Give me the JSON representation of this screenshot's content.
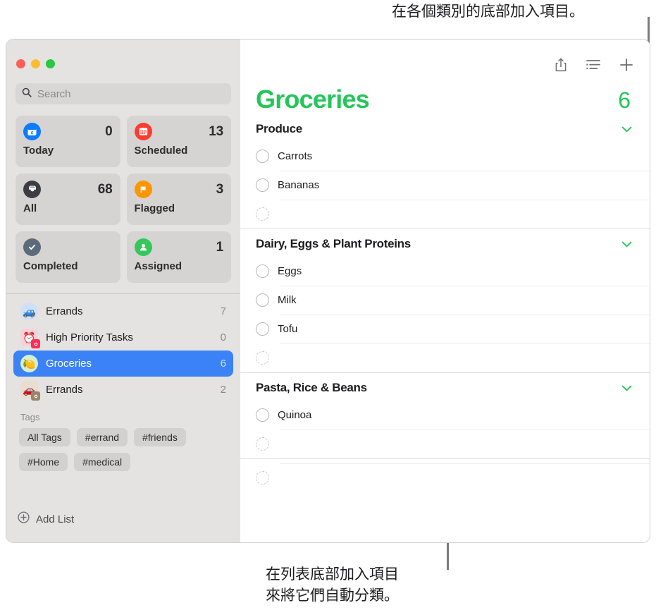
{
  "annotations": {
    "top": "在各個類別的底部加入項目。",
    "bottom": "在列表底部加入項目\n來將它們自動分類。"
  },
  "sidebar": {
    "search": {
      "placeholder": "Search",
      "icon": "search-icon"
    },
    "smart_lists": [
      {
        "label": "Today",
        "count": "0",
        "icon": "calendar-today-icon",
        "color": "#0a7cff"
      },
      {
        "label": "Scheduled",
        "count": "13",
        "icon": "calendar-icon",
        "color": "#ff3b30"
      },
      {
        "label": "All",
        "count": "68",
        "icon": "inbox-icon",
        "color": "#3c3c43"
      },
      {
        "label": "Flagged",
        "count": "3",
        "icon": "flag-icon",
        "color": "#ff9500"
      },
      {
        "label": "Completed",
        "count": "",
        "icon": "checkmark-icon",
        "color": "#5b6b79"
      },
      {
        "label": "Assigned",
        "count": "1",
        "icon": "person-icon",
        "color": "#34c759"
      }
    ],
    "lists": [
      {
        "label": "Errands",
        "count": "7",
        "glyph": "🚙",
        "bg": "#cfe0fa",
        "badge": false,
        "selected": false
      },
      {
        "label": "High Priority Tasks",
        "count": "0",
        "glyph": "⏰",
        "bg": "#fbd0dc",
        "badge": true,
        "badge_color": "#ff2d55",
        "selected": false
      },
      {
        "label": "Groceries",
        "count": "6",
        "glyph": "🍋",
        "bg": "#d3f0cf",
        "badge": false,
        "selected": true
      },
      {
        "label": "Errands",
        "count": "2",
        "glyph": "🚗",
        "bg": "#e8ddd0",
        "badge": true,
        "badge_color": "#9b8568",
        "selected": false
      }
    ],
    "tags_header": "Tags",
    "tags": [
      "All Tags",
      "#errand",
      "#friends",
      "#Home",
      "#medical"
    ],
    "add_list_label": "Add List",
    "add_list_icon": "plus-circle-icon"
  },
  "main": {
    "toolbar": [
      {
        "name": "share-icon"
      },
      {
        "name": "list-options-icon"
      },
      {
        "name": "add-reminder-icon"
      }
    ],
    "title": "Groceries",
    "total": "6",
    "accent": "#23c65a",
    "sections": [
      {
        "title": "Produce",
        "chevron": "⌄",
        "items": [
          {
            "text": "Carrots"
          },
          {
            "text": "Bananas"
          }
        ],
        "new_item_placeholder": ""
      },
      {
        "title": "Dairy, Eggs & Plant Proteins",
        "chevron": "⌄",
        "items": [
          {
            "text": "Eggs"
          },
          {
            "text": "Milk"
          },
          {
            "text": "Tofu"
          }
        ],
        "new_item_placeholder": ""
      },
      {
        "title": "Pasta, Rice & Beans",
        "chevron": "⌄",
        "items": [
          {
            "text": "Quinoa"
          }
        ],
        "new_item_placeholder": ""
      }
    ],
    "list_bottom_new_item_placeholder": ""
  }
}
